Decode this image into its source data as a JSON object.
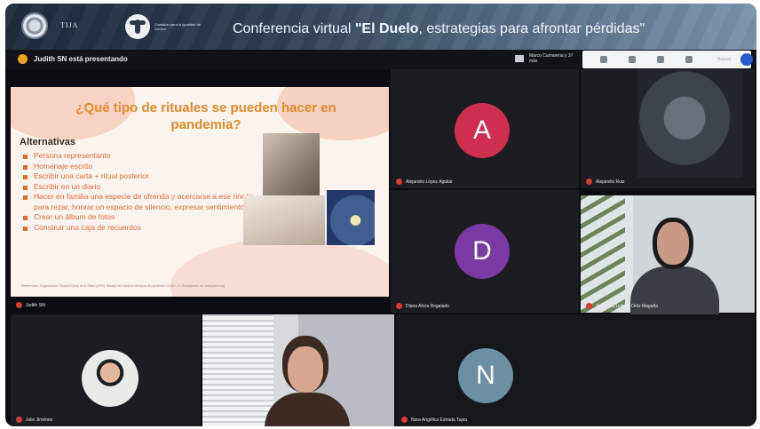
{
  "banner": {
    "logo_text": "TIJA",
    "org_text": "Comisión para la Igualdad de Género",
    "conference_prefix": "Conferencia virtual ",
    "conference_bold": "\"El Duelo",
    "conference_suffix": ", estrategias para afrontar pérdidas\""
  },
  "topbar": {
    "presenting": "Judith SN está presentando",
    "view_label": "Marco Camarena y 37 más",
    "search_hint": "Buscar"
  },
  "slide": {
    "title": "¿Qué tipo de rituales se pueden hacer en pandemia?",
    "alt_heading": "Alternativas",
    "items": [
      "Persona representante",
      "Homenaje escrito",
      "Escribir una carta + ritual posterior",
      "Escribir en un diario",
      "Hacer en familia una especie de ofrenda y acercarse a ese rincón para rezar, honrar un espacio de silencio, expresar sentimientos",
      "Crear un álbum de fotos",
      "Construir una caja de recuerdos"
    ],
    "footnote": "Referencias: Organización Panamericana de la Salud (OPS). Manejo del duelo en tiempos de pandemia COVID-19. Recuperado de: www.paho.org"
  },
  "participants": {
    "presenter": "Judith SN",
    "alejandro_lopez": "Alejandro López Aguilar",
    "alejandro_ruiz": "Alejandro Ruiz",
    "diana": "Diana Alicia Regalado",
    "woman_cam": "Alejandra Lizbeth Ortiz Magaña",
    "photo_user": "Julio Jiménez",
    "girl_cam": "",
    "n_user": "Nora Angélica Estrada Tapia"
  },
  "avatars": {
    "a": "A",
    "d": "D",
    "n": "N"
  },
  "colors": {
    "avatar_a": "#cf2f4f",
    "avatar_d": "#7b3aa3",
    "avatar_n": "#6c8fa6",
    "mic_muted": "#d93a34",
    "presenter_dot": "#f0a020",
    "slide_title": "#e08a2c"
  }
}
